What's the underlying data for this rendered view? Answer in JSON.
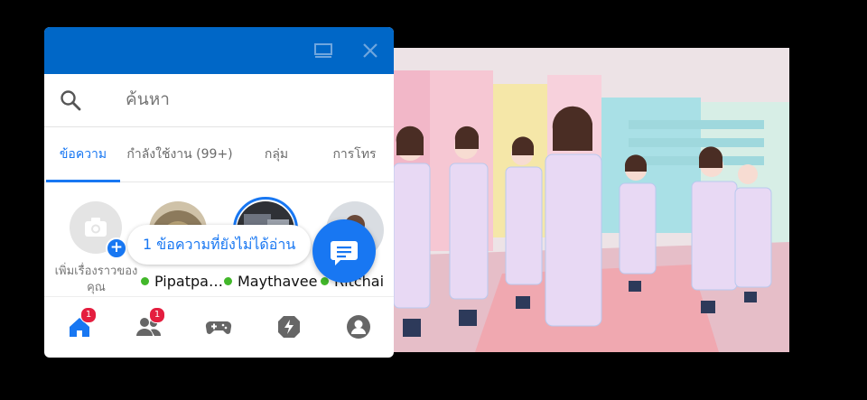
{
  "colors": {
    "titlebar": "#0067c7",
    "accent": "#1877f2",
    "online": "#42b72a",
    "badge": "#e41e3f"
  },
  "titlebar": {
    "icons": [
      "minimize-window-icon",
      "close-icon"
    ]
  },
  "search": {
    "placeholder": "ค้นหา"
  },
  "tabs": [
    {
      "label": "ข้อความ",
      "active": true
    },
    {
      "label": "กำลังใช้งาน (99+)",
      "active": false
    },
    {
      "label": "กลุ่ม",
      "active": false
    },
    {
      "label": "การโทร",
      "active": false
    }
  ],
  "stories": {
    "add_story_label": "เพิ่มเรื่องราวของคุณ",
    "people": [
      {
        "name": "Pipatpa…",
        "online": true
      },
      {
        "name": "Maythavee",
        "online": true
      },
      {
        "name": "Ritchai",
        "online": true
      }
    ]
  },
  "unread_pill": "1 ข้อความที่ยังไม่ได้อ่าน",
  "bottom_nav": [
    {
      "icon": "home-icon",
      "badge": "1",
      "active": true
    },
    {
      "icon": "people-icon",
      "badge": "1",
      "active": false
    },
    {
      "icon": "game-controller-icon",
      "badge": "",
      "active": false
    },
    {
      "icon": "lightning-icon",
      "badge": "",
      "active": false
    },
    {
      "icon": "profile-icon",
      "badge": "",
      "active": false
    }
  ]
}
